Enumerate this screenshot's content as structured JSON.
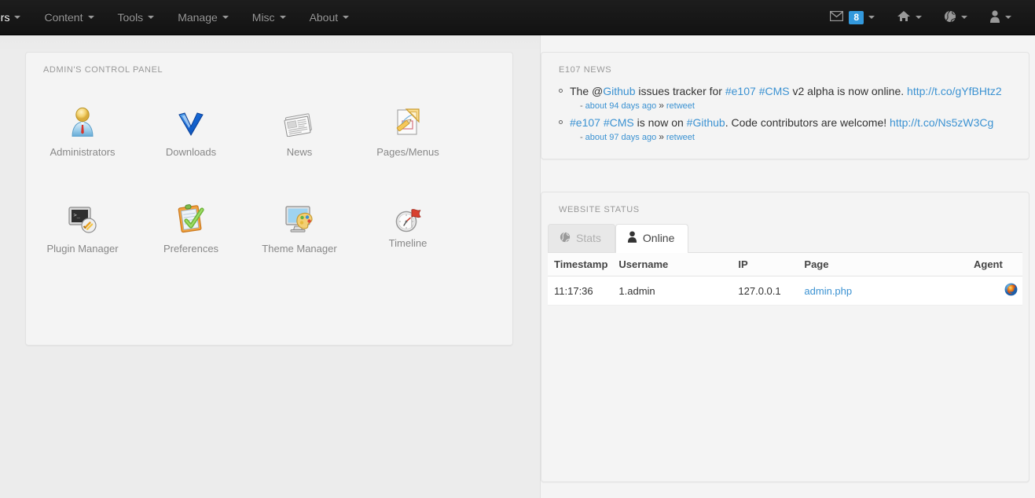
{
  "navbar": {
    "menus": [
      {
        "label": "ers",
        "icon": "chevron-down-icon"
      },
      {
        "label": "Content",
        "icon": "chevron-down-icon"
      },
      {
        "label": "Tools",
        "icon": "chevron-down-icon"
      },
      {
        "label": "Manage",
        "icon": "chevron-down-icon"
      },
      {
        "label": "Misc",
        "icon": "chevron-down-icon"
      },
      {
        "label": "About",
        "icon": "chevron-down-icon"
      }
    ],
    "right": {
      "mail_icon": "envelope-icon",
      "mail_badge": "8",
      "home_icon": "home-icon",
      "globe_icon": "globe-icon",
      "user_icon": "user-icon"
    },
    "colors": {
      "background": "#181818",
      "text": "#999999",
      "badge": "#3399dd"
    }
  },
  "cpanel": {
    "title": "ADMIN'S CONTROL PANEL",
    "items": [
      {
        "label": "Administrators",
        "icon": "administrator-user-icon"
      },
      {
        "label": "Downloads",
        "icon": "download-chevron-icon"
      },
      {
        "label": "News",
        "icon": "newspaper-icon"
      },
      {
        "label": "Pages/Menus",
        "icon": "page-ruler-pencil-icon"
      },
      {
        "label": "Plugin Manager",
        "icon": "console-plug-icon"
      },
      {
        "label": "Preferences",
        "icon": "clipboard-check-icon"
      },
      {
        "label": "Theme Manager",
        "icon": "monitor-palette-icon"
      },
      {
        "label": "Timeline",
        "icon": "clock-flag-icon"
      }
    ]
  },
  "news": {
    "title": "E107 NEWS",
    "items": [
      {
        "parts": [
          {
            "text": "The @",
            "type": "text"
          },
          {
            "text": "Github",
            "type": "link"
          },
          {
            "text": " issues tracker for ",
            "type": "text"
          },
          {
            "text": "#e107",
            "type": "link"
          },
          {
            "text": " ",
            "type": "text"
          },
          {
            "text": "#CMS",
            "type": "link"
          },
          {
            "text": " v2 alpha is now online. ",
            "type": "text"
          },
          {
            "text": "http://t.co/gYfBHtz2",
            "type": "link"
          }
        ],
        "time": "about 94 days ago",
        "action": "retweet"
      },
      {
        "parts": [
          {
            "text": "#e107",
            "type": "link"
          },
          {
            "text": " ",
            "type": "text"
          },
          {
            "text": "#CMS",
            "type": "link"
          },
          {
            "text": " is now on ",
            "type": "text"
          },
          {
            "text": "#Github",
            "type": "link"
          },
          {
            "text": ". Code contributors are welcome! ",
            "type": "text"
          },
          {
            "text": "http://t.co/Ns5zW3Cg",
            "type": "link"
          }
        ],
        "time": "about 97 days ago",
        "action": "retweet"
      }
    ],
    "link_color": "#3b92d2"
  },
  "status": {
    "title": "WEBSITE STATUS",
    "tabs": [
      {
        "label": "Stats",
        "icon": "globe-icon",
        "active": false
      },
      {
        "label": "Online",
        "icon": "user-icon",
        "active": true
      }
    ],
    "table": {
      "columns": [
        "Timestamp",
        "Username",
        "IP",
        "Page",
        "Agent"
      ],
      "rows": [
        {
          "timestamp": "11:17:36",
          "username": "1.admin",
          "ip": "127.0.0.1",
          "page": "admin.php",
          "agent": "firefox-icon"
        }
      ]
    }
  }
}
